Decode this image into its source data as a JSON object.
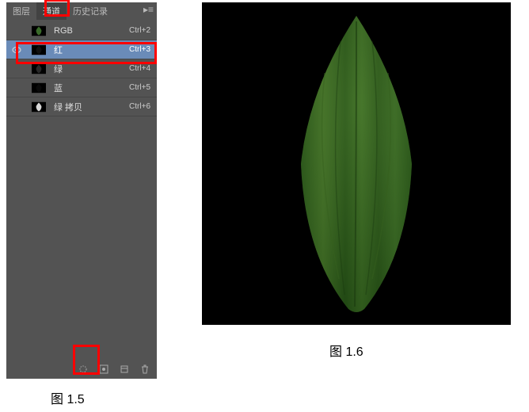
{
  "tabs": {
    "layers": "图层",
    "channels": "通道",
    "history": "历史记录"
  },
  "channels": [
    {
      "vis": "",
      "name": "RGB",
      "key": "Ctrl+2",
      "sel": false,
      "fill": "#3a6b2a",
      "bg": "#000"
    },
    {
      "vis": "●",
      "name": "红",
      "key": "Ctrl+3",
      "sel": true,
      "fill": "#111",
      "bg": "#000"
    },
    {
      "vis": "",
      "name": "绿",
      "key": "Ctrl+4",
      "sel": false,
      "fill": "#282828",
      "bg": "#000"
    },
    {
      "vis": "",
      "name": "蓝",
      "key": "Ctrl+5",
      "sel": false,
      "fill": "#0a0a0a",
      "bg": "#000"
    },
    {
      "vis": "",
      "name": "绿 拷贝",
      "key": "Ctrl+6",
      "sel": false,
      "fill": "#d8d8d8",
      "bg": "#000"
    }
  ],
  "captions": {
    "left": "图 1.5",
    "right": "图 1.6"
  }
}
